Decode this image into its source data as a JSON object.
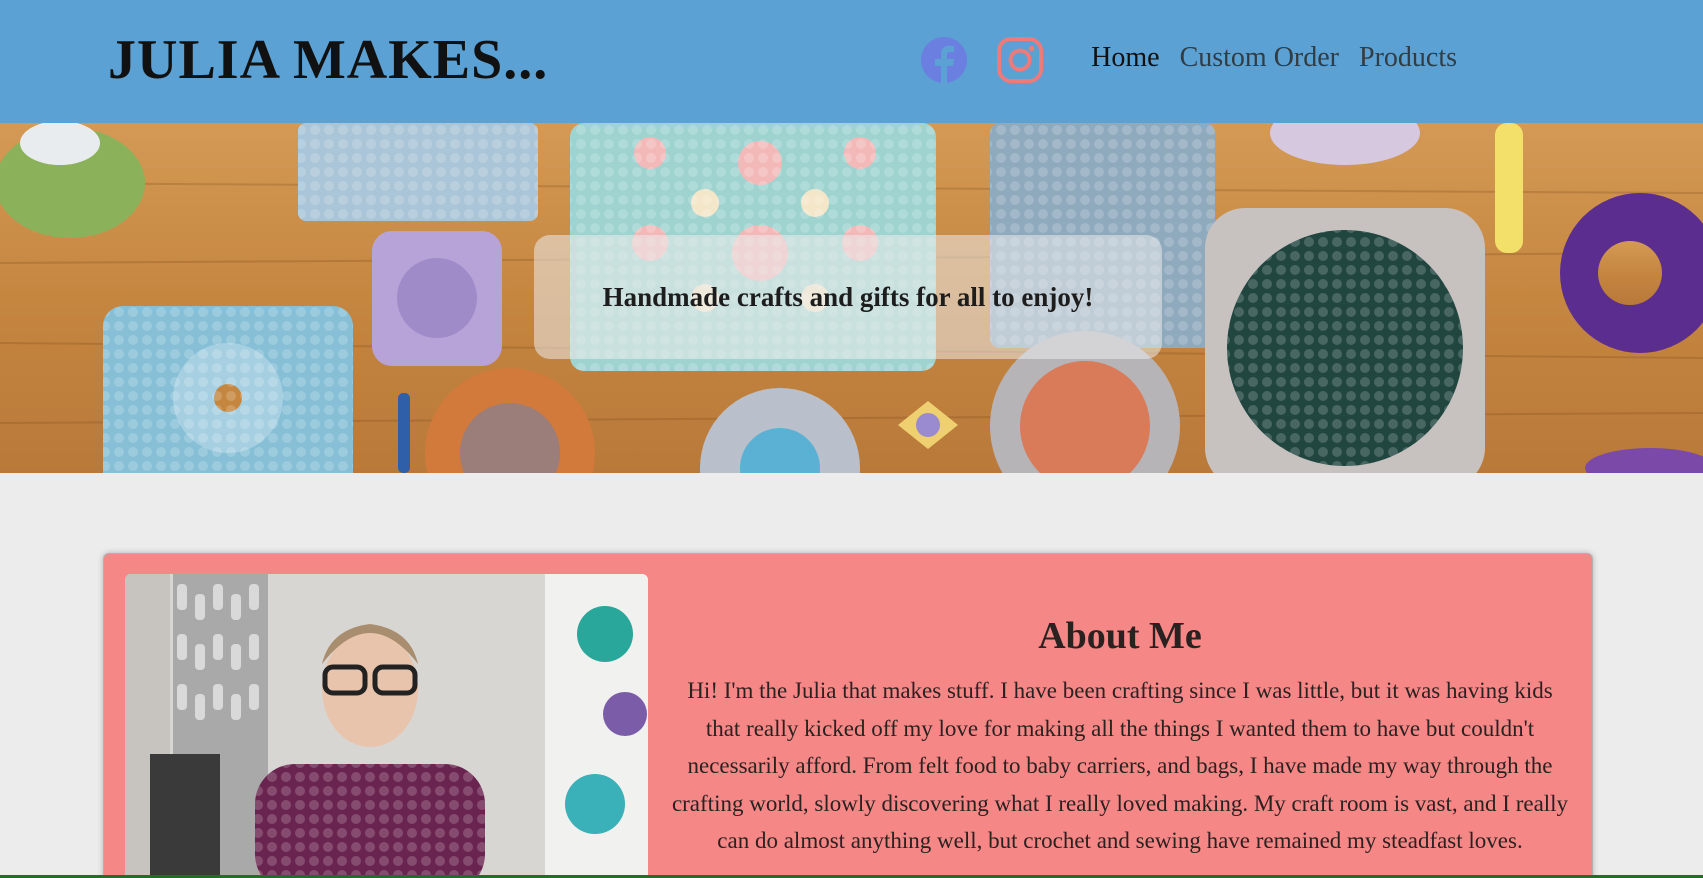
{
  "header": {
    "logo": "JULIA MAKES...",
    "nav": [
      {
        "label": "Home",
        "active": true
      },
      {
        "label": "Custom Order",
        "active": false
      },
      {
        "label": "Products",
        "active": false
      }
    ],
    "social": [
      "facebook-icon",
      "instagram-icon"
    ],
    "colors": {
      "background": "#5ba1d4",
      "facebook": "#6b7fe0",
      "instagram": "#ef7a7a"
    }
  },
  "hero": {
    "tagline": "Handmade crafts and gifts for all to enjoy!"
  },
  "about": {
    "title": "About Me",
    "text": "Hi! I'm the Julia that makes stuff. I have been crafting since I was little, but it was having kids that really kicked off my love for making all the things I wanted them to have but couldn't necessarily afford. From felt food to baby carriers, and bags, I have made my way through the crafting world, slowly discovering what I really loved making. My craft room is vast, and I really can do almost anything well, but crochet and sewing have remained my steadfast loves.",
    "colors": {
      "card": "#f68787"
    }
  }
}
